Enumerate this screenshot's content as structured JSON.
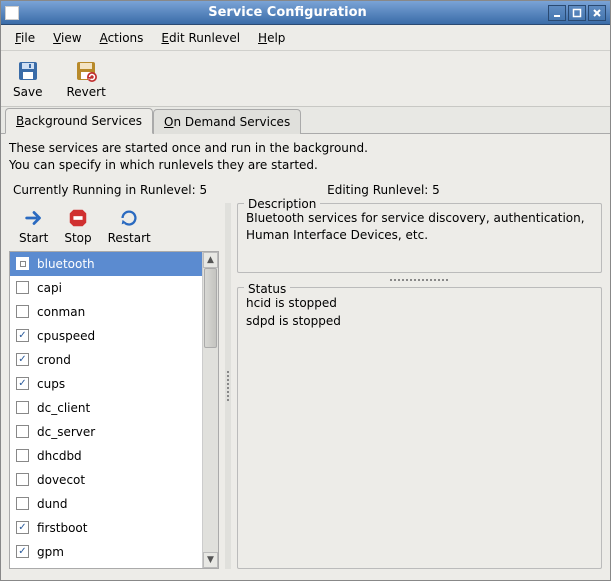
{
  "window": {
    "title": "Service Configuration"
  },
  "menu": {
    "file": "File",
    "view": "View",
    "actions": "Actions",
    "edit_runlevel": "Edit Runlevel",
    "help": "Help"
  },
  "toolbar": {
    "save": "Save",
    "revert": "Revert"
  },
  "tabs": {
    "background": "Background Services",
    "ondemand": "On Demand Services"
  },
  "intro": {
    "line1": "These services are started once and run in the background.",
    "line2": "You can specify in which runlevels they are started."
  },
  "runlevel": {
    "running_label": "Currently Running in Runlevel:",
    "running_value": "5",
    "editing_label": "Editing Runlevel:",
    "editing_value": "5"
  },
  "actions": {
    "start": "Start",
    "stop": "Stop",
    "restart": "Restart"
  },
  "services": [
    {
      "name": "bluetooth",
      "checked": false,
      "selected": true
    },
    {
      "name": "capi",
      "checked": false
    },
    {
      "name": "conman",
      "checked": false
    },
    {
      "name": "cpuspeed",
      "checked": true
    },
    {
      "name": "crond",
      "checked": true
    },
    {
      "name": "cups",
      "checked": true
    },
    {
      "name": "dc_client",
      "checked": false
    },
    {
      "name": "dc_server",
      "checked": false
    },
    {
      "name": "dhcdbd",
      "checked": false
    },
    {
      "name": "dovecot",
      "checked": false
    },
    {
      "name": "dund",
      "checked": false
    },
    {
      "name": "firstboot",
      "checked": true
    },
    {
      "name": "gpm",
      "checked": true
    }
  ],
  "description": {
    "label": "Description",
    "text": "Bluetooth services for service discovery, authentication, Human Interface Devices, etc."
  },
  "status": {
    "label": "Status",
    "line1": "hcid is stopped",
    "line2": "sdpd is stopped"
  }
}
